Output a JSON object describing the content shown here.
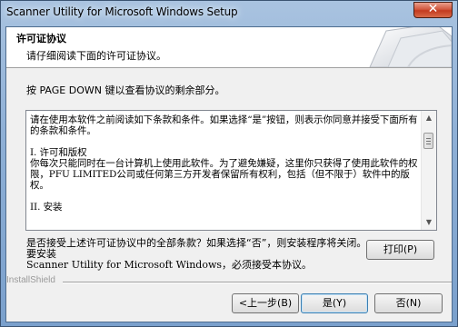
{
  "window": {
    "title": "Scanner Utility for Microsoft Windows Setup",
    "close_glyph": "✕"
  },
  "header": {
    "title": "许可证协议",
    "subtitle": "请仔细阅读下面的许可证协议。"
  },
  "instruction": "按 PAGE DOWN 键以查看协议的剩余部分。",
  "license": {
    "p1": "请在使用本软件之前阅读如下条款和条件。如果选择“是”按钮，则表示你同意并接受下面所有的条款和条件。",
    "p2_title": "I. 许可和版权",
    "p2_body": "你每次只能同时在一台计算机上使用此软件。为了避免嫌疑，这里你只获得了使用此软件的权限，PFU LIMITED公司或任何第三方开发者保留所有权利，包括（但不限于）软件中的版权。",
    "p3_title": "II. 安装"
  },
  "question": {
    "line1": "是否接受上述许可证协议中的全部条款？如果选择“否”，则安装程序将关闭。要安装",
    "line2": "Scanner Utility for Microsoft Windows，必须接受本协议。"
  },
  "buttons": {
    "print": "打印(P)",
    "back": "<上一步(B)",
    "yes": "是(Y)",
    "no": "否(N)"
  },
  "brand": "InstallShield"
}
